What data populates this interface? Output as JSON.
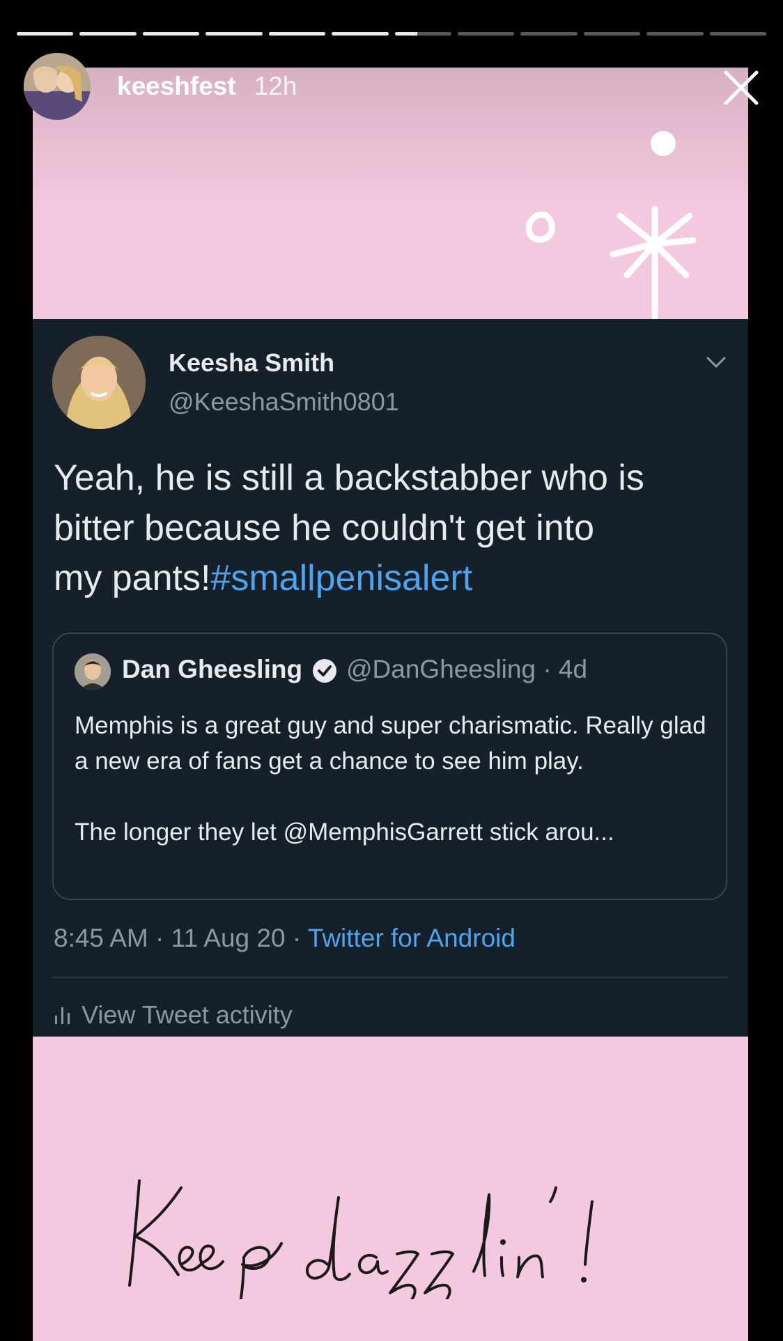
{
  "story": {
    "username": "keeshfest",
    "time_ago": "12h",
    "segments_total": 12,
    "current_segment": 7,
    "current_segment_progress": 0.4
  },
  "tweet": {
    "display_name": "Keesha Smith",
    "handle": "@KeeshaSmith0801",
    "text_lines": [
      "Yeah, he is still a backstabber who is",
      "bitter because he couldn't get into",
      "my pants!"
    ],
    "hashtag": "#smallpenisalert",
    "quoted": {
      "display_name": "Dan Gheesling",
      "handle_time": "@DanGheesling · 4d",
      "paragraph1": "Memphis is a great guy and super charismatic. Really glad a new era of fans get a chance to see him play.",
      "paragraph2": "The longer they let @MemphisGarrett stick arou..."
    },
    "timestamp": "8:45 AM · 11 Aug 20 · ",
    "source": "Twitter for Android",
    "activity_label": "View Tweet activity"
  },
  "caption": "Keep dazzlin'!",
  "colors": {
    "story_background": "#f4c8de",
    "tweet_background": "#15202b",
    "link": "#4ea5ee",
    "muted": "#8899a6"
  }
}
